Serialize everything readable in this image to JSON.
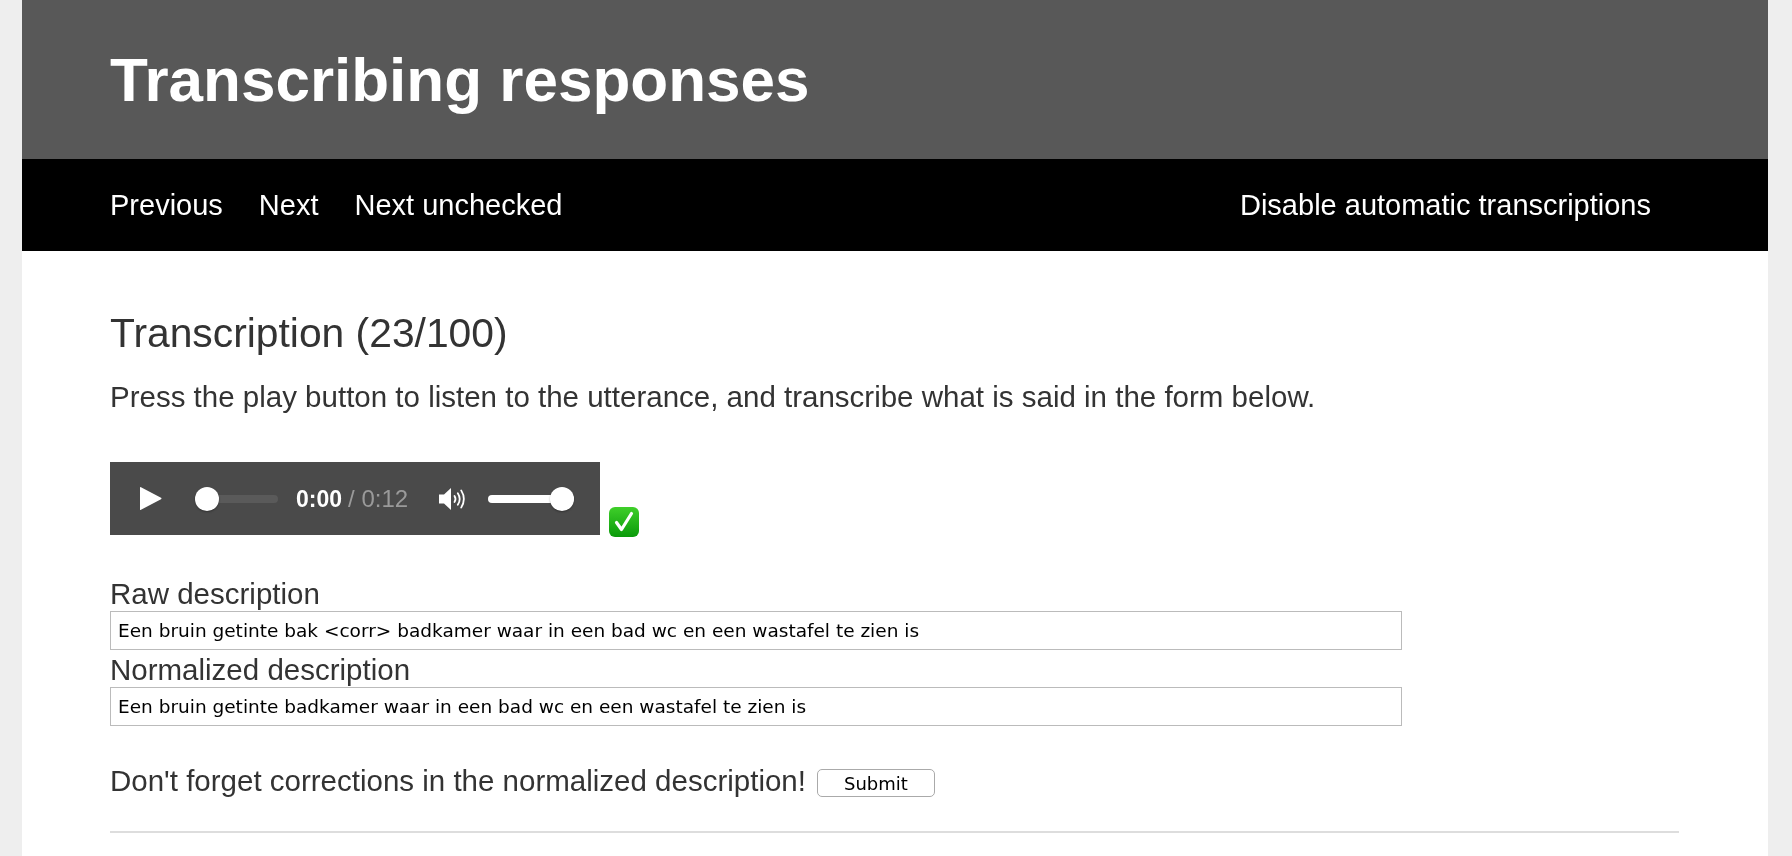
{
  "page_title": "Transcribing responses",
  "nav": {
    "links": [
      "Previous",
      "Next",
      "Next unchecked"
    ],
    "right_link": "Disable automatic transcriptions"
  },
  "heading": "Transcription (23/100)",
  "instructions": "Press the play button to listen to the utterance, and transcribe what is said in the form below.",
  "audio": {
    "current_time": "0:00",
    "duration": "/ 0:12",
    "progress": {
      "level": 0
    },
    "volume": {
      "level": 1
    },
    "checked": true
  },
  "fields": [
    {
      "label": "Raw description",
      "value": "Een bruin getinte bak <corr> badkamer waar in een bad wc en een wastafel te zien is"
    },
    {
      "label": "Normalized description",
      "value": "Een bruin getinte badkamer waar in een bad wc en een wastafel te zien is"
    }
  ],
  "footer": {
    "note": "Don't forget corrections in the normalized description!",
    "submit": "Submit"
  }
}
